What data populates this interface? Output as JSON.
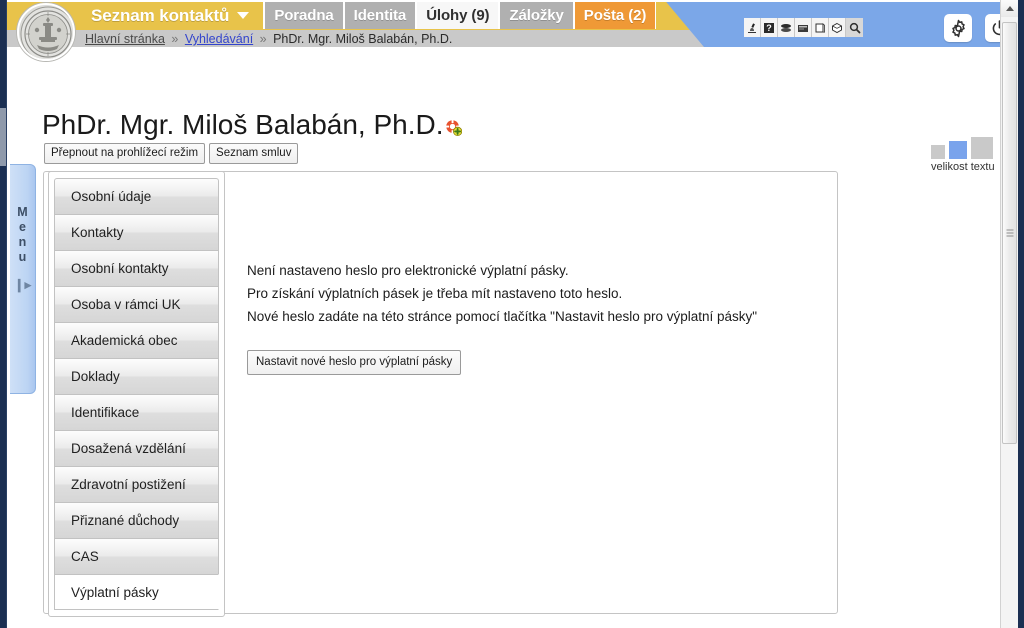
{
  "header": {
    "logo_alt": "Charles University seal",
    "tabs": [
      {
        "label": "Seznam kontaktů",
        "style": "main",
        "has_caret": true
      },
      {
        "label": "Poradna",
        "style": "normal",
        "has_caret": false
      },
      {
        "label": "Identita",
        "style": "normal",
        "has_caret": false
      },
      {
        "label": "Úlohy (9)",
        "style": "active-light",
        "has_caret": false
      },
      {
        "label": "Záložky",
        "style": "normal",
        "has_caret": false
      },
      {
        "label": "Pošta (2)",
        "style": "mail",
        "has_caret": false
      }
    ],
    "breadcrumb": {
      "home": "Hlavní stránka",
      "sep": "»",
      "link": "Vyhledávání",
      "current": "PhDr. Mgr. Miloš Balabán, Ph.D."
    },
    "toolbar_icons": [
      "microscope-icon",
      "help-question-icon",
      "layers-icon",
      "card-file-icon",
      "book-icon",
      "cube-icon",
      "search-icon"
    ],
    "round_buttons": [
      {
        "name": "settings-gear-button",
        "icon": "gear-icon"
      },
      {
        "name": "logout-power-button",
        "icon": "power-icon"
      }
    ],
    "colors": {
      "banner_yellow": "#e8c34a",
      "banner_blue": "#7ba7e8",
      "banner_gray": "#c9c9c9",
      "tab_gray": "#b0b0b0",
      "tab_mail_orange": "#ef9936",
      "frame_dark_blue": "#1b2f52"
    }
  },
  "page": {
    "title": "PhDr. Mgr. Miloš Balabán, Ph.D.",
    "title_badge_icon": "lifebuoy-add-icon",
    "action_buttons": [
      {
        "label": "Přepnout na prohlížecí režim"
      },
      {
        "label": "Seznam smluv"
      }
    ]
  },
  "text_size": {
    "label": "velikost textu",
    "options": [
      {
        "name": "small",
        "selected": false
      },
      {
        "name": "medium",
        "selected": true
      },
      {
        "name": "large",
        "selected": false
      }
    ],
    "selected_color": "#79a3ec",
    "unselected_color": "#c9c9c9"
  },
  "menu_tab": {
    "letters": [
      "M",
      "e",
      "n",
      "u"
    ],
    "arrow_icon": "expand-right-icon"
  },
  "nav": {
    "items": [
      {
        "label": "Osobní údaje",
        "selected": false
      },
      {
        "label": "Kontakty",
        "selected": false
      },
      {
        "label": "Osobní kontakty",
        "selected": false
      },
      {
        "label": "Osoba v rámci UK",
        "selected": false
      },
      {
        "label": "Akademická obec",
        "selected": false
      },
      {
        "label": "Doklady",
        "selected": false
      },
      {
        "label": "Identifikace",
        "selected": false
      },
      {
        "label": "Dosažená vzdělání",
        "selected": false
      },
      {
        "label": "Zdravotní postižení",
        "selected": false
      },
      {
        "label": "Přiznané důchody",
        "selected": false
      },
      {
        "label": "CAS",
        "selected": false
      },
      {
        "label": "Výplatní pásky",
        "selected": true
      }
    ]
  },
  "content": {
    "lines": [
      "Není nastaveno heslo pro elektronické výplatní pásky.",
      "Pro získání výplatních pásek je třeba mít nastaveno toto heslo.",
      "Nové heslo zadáte na této stránce pomocí tlačítka \"Nastavit heslo pro výplatní pásky\""
    ],
    "set_password_button": "Nastavit nové heslo pro výplatní pásky"
  },
  "scrollbar": {
    "up_arrow_icon": "chevron-up-icon",
    "thumb_grip_icon": "grip-lines-icon"
  }
}
